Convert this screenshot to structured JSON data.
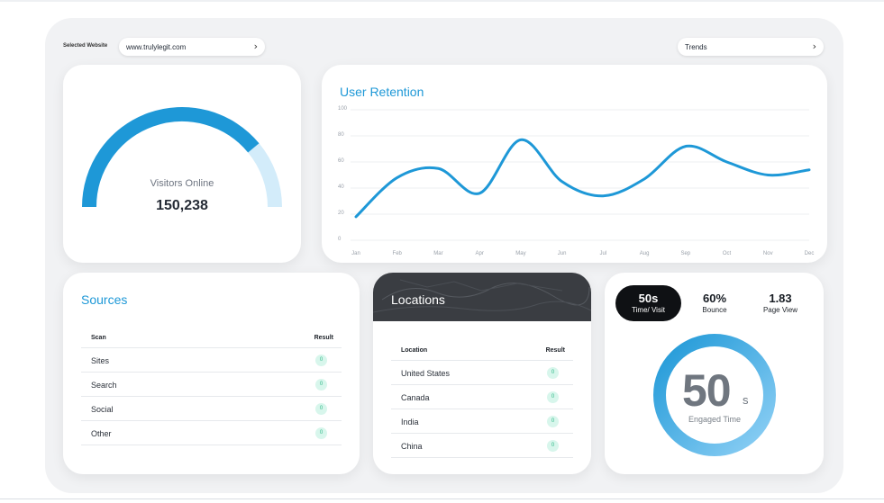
{
  "selector": {
    "label": "Selected Website",
    "website": "www.trulylegit.com",
    "trends": "Trends"
  },
  "visitors": {
    "label": "Visitors Online",
    "value": "150,238",
    "gauge_fraction": 0.78,
    "colors": {
      "fill": "#1e98d7",
      "track": "#d3ecfa"
    }
  },
  "retention": {
    "title": "User Retention"
  },
  "chart_data": {
    "type": "line",
    "title": "User Retention",
    "x": [
      "Jan",
      "Feb",
      "Mar",
      "Apr",
      "May",
      "Jun",
      "Jul",
      "Aug",
      "Sep",
      "Oct",
      "Nov",
      "Dec"
    ],
    "y_ticks": [
      "100",
      "80",
      "60",
      "40",
      "20",
      "0"
    ],
    "ylim": [
      0,
      100
    ],
    "series": [
      {
        "values": [
          18,
          48,
          55,
          36,
          77,
          45,
          34,
          47,
          72,
          60,
          50,
          54
        ]
      }
    ],
    "grid": true,
    "colors": {
      "line": "#1e98d7"
    }
  },
  "sources": {
    "title": "Sources",
    "col_name": "Scan",
    "col_result": "Result",
    "rows": [
      {
        "name": "Sites",
        "result": "0"
      },
      {
        "name": "Search",
        "result": "0"
      },
      {
        "name": "Social",
        "result": "0"
      },
      {
        "name": "Other",
        "result": "0"
      }
    ]
  },
  "locations": {
    "title": "Locations",
    "col_name": "Location",
    "col_result": "Result",
    "rows": [
      {
        "name": "United States",
        "result": "0"
      },
      {
        "name": "Canada",
        "result": "0"
      },
      {
        "name": "India",
        "result": "0"
      },
      {
        "name": "China",
        "result": "0"
      }
    ]
  },
  "engagement": {
    "metrics": [
      {
        "value": "50s",
        "label": "Time/ Visit"
      },
      {
        "value": "60%",
        "label": "Bounce"
      },
      {
        "value": "1.83",
        "label": "Page View"
      }
    ],
    "big_value": "50",
    "unit": "s",
    "label": "Engaged Time",
    "ring_colors": {
      "outer": "#38a6e4",
      "inner": "#b8e0f8"
    }
  }
}
